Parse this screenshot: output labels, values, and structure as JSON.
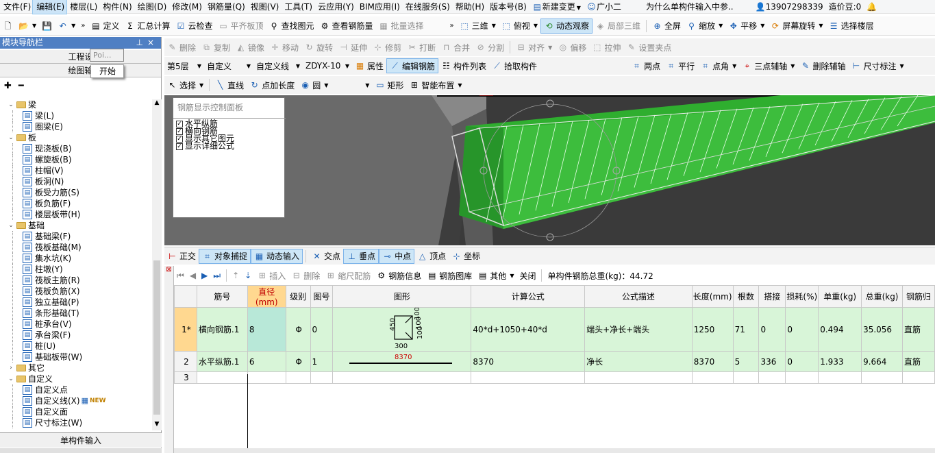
{
  "menubar": {
    "items": [
      "文件(F)",
      "编辑(E)",
      "楼层(L)",
      "构件(N)",
      "绘图(D)",
      "修改(M)",
      "钢筋量(Q)",
      "视图(V)",
      "工具(T)",
      "云应用(Y)",
      "BIM应用(I)",
      "在线服务(S)",
      "帮助(H)",
      "版本号(B)"
    ],
    "new_change": "新建变更",
    "guang": "广小二",
    "question": "为什么单构件输入中参..",
    "phone": "13907298339",
    "coins": "造价豆:0"
  },
  "toolbar1": {
    "define": "定义",
    "sum": "汇总计算",
    "cloud_check": "云检查",
    "flat_top": "平齐板顶",
    "find": "查找图元",
    "view_rebar": "查看钢筋量",
    "batch_select": "批量选择",
    "view3d": "三维",
    "top_view": "俯视",
    "dynamic": "动态观察",
    "local3d": "局部三维",
    "fullscreen": "全屏",
    "zoom": "缩放",
    "pan": "平移",
    "rotate_screen": "屏幕旋转",
    "select_floor": "选择楼层"
  },
  "leftpanel": {
    "title": "模块导航栏",
    "tab1": "工程设",
    "tab2": "绘图输",
    "popup_poi": "Poi...",
    "popup_start": "开始",
    "bottom1": "单构件输入",
    "tree": [
      {
        "type": "folder",
        "label": "梁",
        "indent": 0
      },
      {
        "type": "leaf",
        "label": "梁(L)",
        "icon": "beam-icon"
      },
      {
        "type": "leaf",
        "label": "圈梁(E)",
        "icon": "ring-beam-icon"
      },
      {
        "type": "folder",
        "label": "板",
        "indent": 0
      },
      {
        "type": "leaf",
        "label": "现浇板(B)",
        "icon": "slab-icon"
      },
      {
        "type": "leaf",
        "label": "螺旋板(B)",
        "icon": "spiral-slab-icon"
      },
      {
        "type": "leaf",
        "label": "柱帽(V)",
        "icon": "column-cap-icon"
      },
      {
        "type": "leaf",
        "label": "板洞(N)",
        "icon": "slab-hole-icon"
      },
      {
        "type": "leaf",
        "label": "板受力筋(S)",
        "icon": "slab-rebar-icon"
      },
      {
        "type": "leaf",
        "label": "板负筋(F)",
        "icon": "slab-neg-rebar-icon"
      },
      {
        "type": "leaf",
        "label": "楼层板带(H)",
        "icon": "floor-strip-icon"
      },
      {
        "type": "folder",
        "label": "基础",
        "indent": 0
      },
      {
        "type": "leaf",
        "label": "基础梁(F)",
        "icon": "foundation-beam-icon"
      },
      {
        "type": "leaf",
        "label": "筏板基础(M)",
        "icon": "raft-icon"
      },
      {
        "type": "leaf",
        "label": "集水坑(K)",
        "icon": "sump-icon"
      },
      {
        "type": "leaf",
        "label": "柱墩(Y)",
        "icon": "pier-icon"
      },
      {
        "type": "leaf",
        "label": "筏板主筋(R)",
        "icon": "raft-main-icon"
      },
      {
        "type": "leaf",
        "label": "筏板负筋(X)",
        "icon": "raft-neg-icon"
      },
      {
        "type": "leaf",
        "label": "独立基础(P)",
        "icon": "isolated-icon"
      },
      {
        "type": "leaf",
        "label": "条形基础(T)",
        "icon": "strip-icon"
      },
      {
        "type": "leaf",
        "label": "桩承台(V)",
        "icon": "pile-cap-icon"
      },
      {
        "type": "leaf",
        "label": "承台梁(F)",
        "icon": "cap-beam-icon"
      },
      {
        "type": "leaf",
        "label": "桩(U)",
        "icon": "pile-icon"
      },
      {
        "type": "leaf",
        "label": "基础板带(W)",
        "icon": "foundation-strip-icon"
      },
      {
        "type": "folder-closed",
        "label": "其它",
        "indent": 0
      },
      {
        "type": "folder",
        "label": "自定义",
        "indent": 0
      },
      {
        "type": "leaf",
        "label": "自定义点",
        "icon": "custom-point-icon"
      },
      {
        "type": "leaf",
        "label": "自定义线(X)",
        "icon": "custom-line-icon",
        "badge": "NEW"
      },
      {
        "type": "leaf",
        "label": "自定义面",
        "icon": "custom-face-icon"
      },
      {
        "type": "leaf",
        "label": "尺寸标注(W)",
        "icon": "dimension-icon"
      }
    ]
  },
  "edit_toolbar": {
    "delete": "删除",
    "copy": "复制",
    "mirror": "镜像",
    "move": "移动",
    "rotate": "旋转",
    "extend": "延伸",
    "trim": "修剪",
    "break": "打断",
    "merge": "合并",
    "split": "分割",
    "align": "对齐",
    "offset": "偏移",
    "stretch": "拉伸",
    "set_grip": "设置夹点"
  },
  "prop_toolbar": {
    "floor": "第5层",
    "custom": "自定义",
    "custom_line": "自定义线",
    "code": "ZDYX-10",
    "attributes": "属性",
    "edit_rebar": "编辑钢筋",
    "member_list": "构件列表",
    "pick_member": "拾取构件",
    "two_points": "两点",
    "parallel": "平行",
    "point_angle": "点角",
    "three_point_aux": "三点辅轴",
    "delete_aux": "删除辅轴",
    "dim": "尺寸标注"
  },
  "draw_toolbar": {
    "select": "选择",
    "line": "直线",
    "point_length": "点加长度",
    "circle": "圆",
    "rect": "矩形",
    "smart": "智能布置"
  },
  "viewport_panel": {
    "title": "钢筋显示控制面板",
    "options": [
      "水平纵筋",
      "横向钢筋",
      "显示其它图元",
      "显示详细公式"
    ]
  },
  "snapbar": {
    "ortho": "正交",
    "obj_snap": "对象捕捉",
    "dyn_input": "动态输入",
    "intersect": "交点",
    "perp": "垂点",
    "mid": "中点",
    "vertex": "顶点",
    "coord": "坐标"
  },
  "rebarbar": {
    "insert": "插入",
    "delete": "删除",
    "scale": "缩尺配筋",
    "info": "钢筋信息",
    "library": "钢筋图库",
    "other": "其他",
    "close": "关闭",
    "total_label": "单构件钢筋总重(kg)：44.72"
  },
  "table": {
    "headers": [
      "",
      "筋号",
      "直径(mm)",
      "级别",
      "图号",
      "图形",
      "计算公式",
      "公式描述",
      "长度(mm)",
      "根数",
      "搭接",
      "损耗(%)",
      "单重(kg)",
      "总重(kg)",
      "钢筋归"
    ],
    "rows": [
      {
        "no": "1*",
        "name": "横向钢筋.1",
        "dia": "8",
        "grade": "Φ",
        "fig": "0",
        "shape": {
          "w": "300",
          "h": "450",
          "r1": "100",
          "r2": "100",
          "r3": "100"
        },
        "formula": "40*d+1050+40*d",
        "desc": "端头+净长+端头",
        "len": "1250",
        "count": "71",
        "lap": "0",
        "loss": "0",
        "unit": "0.494",
        "total": "35.056",
        "type": "直筋"
      },
      {
        "no": "2",
        "name": "水平纵筋.1",
        "dia": "6",
        "grade": "Φ",
        "fig": "1",
        "shape": {
          "len": "8370"
        },
        "formula": "8370",
        "desc": "净长",
        "len": "8370",
        "count": "5",
        "lap": "336",
        "loss": "0",
        "unit": "1.933",
        "total": "9.664",
        "type": "直筋"
      },
      {
        "no": "3",
        "name": "",
        "dia": "",
        "grade": "",
        "fig": "",
        "formula": "",
        "desc": "",
        "len": "",
        "count": "",
        "lap": "",
        "loss": "",
        "unit": "",
        "total": "",
        "type": ""
      }
    ]
  }
}
